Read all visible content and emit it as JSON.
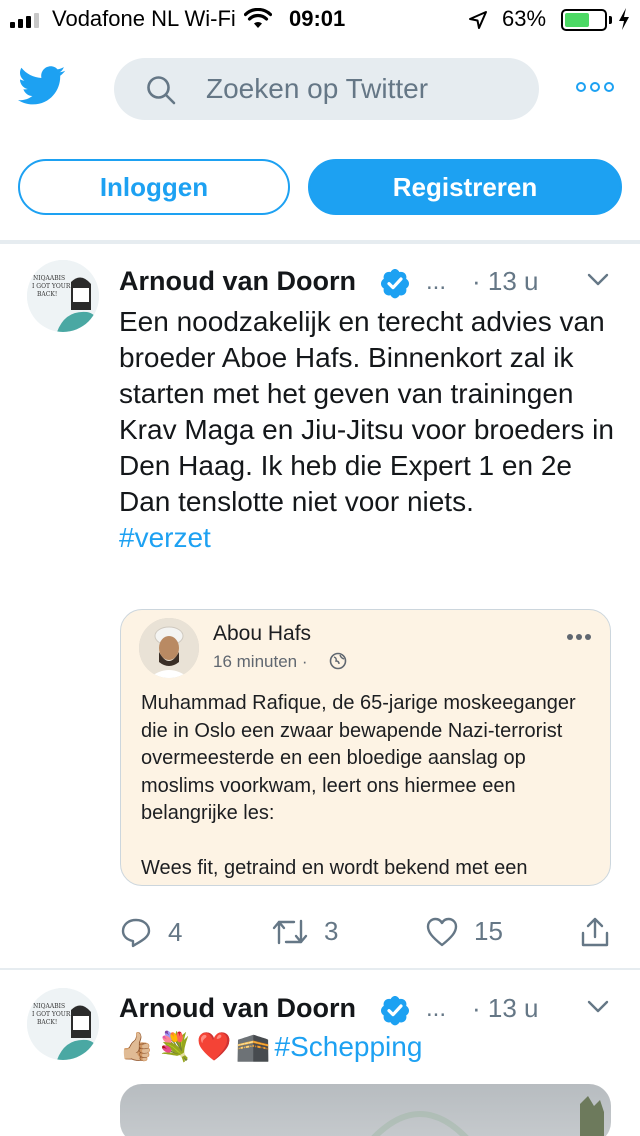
{
  "status_bar": {
    "carrier": "Vodafone NL Wi-Fi",
    "time": "09:01",
    "battery_percent": "63%",
    "battery_level": 0.63,
    "signal_bars": 3,
    "icons": [
      "signal-icon",
      "wifi-icon",
      "location-icon",
      "battery-icon",
      "charging-icon"
    ]
  },
  "header": {
    "logo": "twitter-logo-icon",
    "search_placeholder": "Zoeken op Twitter",
    "more_icon": "more-icon",
    "login_label": "Inloggen",
    "register_label": "Registreren"
  },
  "colors": {
    "accent": "#1da1f2",
    "text": "#14171a",
    "secondary_text": "#657786",
    "divider": "#e6ecf0",
    "quote_bg": "#fdf3e4"
  },
  "tweets": [
    {
      "author": "Arnoud van Doorn",
      "verified": true,
      "ellipsis": "...",
      "time": "· 13 u",
      "text": "Een noodzakelijk en terecht advies van broeder Aboe Hafs. Binnenkort zal ik starten met het geven van trainingen Krav Maga en Jiu-Jitsu voor broeders in Den Haag. Ik heb die Expert 1 en 2e Dan tenslotte niet voor niets.",
      "hashtag": "#verzet",
      "quote": {
        "author": "Abou Hafs",
        "time": "16 minuten ·",
        "text": "Muhammad Rafique, de 65-jarige moskeeganger die in Oslo een zwaar bewapende Nazi-terrorist overmeesterde en een bloedige aanslag op moslims voorkwam, leert ons hiermee een belangrijke les:\n\nWees fit, getraind en wordt bekend met een"
      },
      "actions": {
        "replies": "4",
        "retweets": "3",
        "likes": "15"
      }
    },
    {
      "author": "Arnoud van Doorn",
      "verified": true,
      "ellipsis": "...",
      "time": "· 13 u",
      "emojis": [
        "👍🏼",
        "💐",
        "❤️",
        "🕋"
      ],
      "hashtag": "#Schepping"
    }
  ]
}
